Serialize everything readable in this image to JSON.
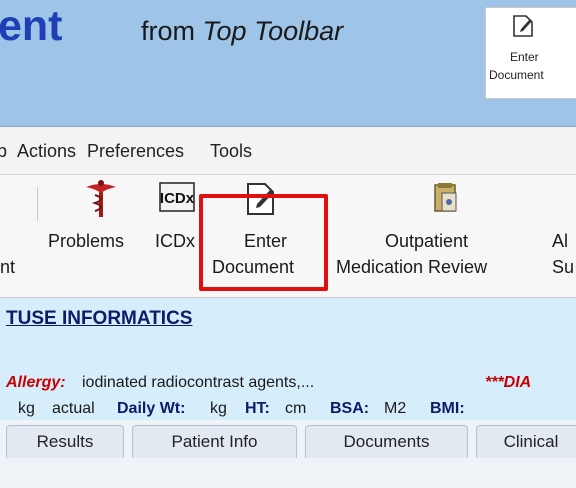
{
  "title": {
    "word": "ent",
    "from": "from",
    "toolbar_name": "Top Toolbar"
  },
  "mini_button": {
    "line1": "Enter",
    "line2": "Document",
    "icon": "enter-document-icon"
  },
  "menu": [
    "p",
    "Actions",
    "Preferences",
    "Tools"
  ],
  "toolbar": {
    "items": [
      {
        "line1": "l",
        "line2": "nt"
      },
      {
        "line1": "Problems",
        "line2": "",
        "icon": "caduceus-icon"
      },
      {
        "line1": "ICDx",
        "line2": "",
        "icon": "icdx-icon"
      },
      {
        "line1": "Enter",
        "line2": "Document",
        "icon": "enter-document-icon"
      },
      {
        "line1": "Outpatient",
        "line2": "Medication Review",
        "icon": "medication-review-icon"
      },
      {
        "line1": "Al",
        "line2": "Su"
      }
    ]
  },
  "patient": {
    "name": "TUSE INFORMATICS",
    "allergy_label": "Allergy:",
    "allergy_value": "iodinated radiocontrast agents,...",
    "allergy_flag": "***DIA",
    "vitals": {
      "wt_value": "kg",
      "wt_type": "actual",
      "daily_wt_label": "Daily Wt:",
      "daily_wt_unit": "kg",
      "ht_label": "HT:",
      "ht_unit": "cm",
      "bsa_label": "BSA:",
      "bsa_unit": "M2",
      "bmi_label": "BMI:"
    }
  },
  "tabs": [
    "Results",
    "Patient Info",
    "Documents",
    "Clinical"
  ],
  "colors": {
    "title": "#1f3fb7",
    "highlight": "#e01010",
    "allergy": "#c80000",
    "background": "#9ec5e8"
  }
}
